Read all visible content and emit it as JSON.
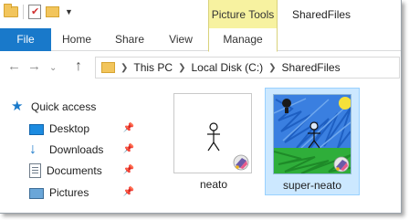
{
  "window": {
    "title": "SharedFiles",
    "context_tab_group": "Picture Tools"
  },
  "quick_access_toolbar": {
    "icons": [
      "folder-icon",
      "properties-icon",
      "new-folder-icon",
      "customize-dropdown-icon"
    ]
  },
  "ribbon": {
    "tabs": [
      {
        "label": "File",
        "active": true,
        "color": "#1979ca"
      },
      {
        "label": "Home"
      },
      {
        "label": "Share"
      },
      {
        "label": "View"
      },
      {
        "label": "Manage"
      }
    ],
    "context_color": "#f7f2a0"
  },
  "address_bar": {
    "breadcrumbs": [
      "This PC",
      "Local Disk (C:)",
      "SharedFiles"
    ]
  },
  "nav_pane": {
    "items": [
      {
        "label": "Quick access",
        "icon": "star-icon",
        "pinned": false
      },
      {
        "label": "Desktop",
        "icon": "desktop-icon",
        "pinned": true
      },
      {
        "label": "Downloads",
        "icon": "downloads-icon",
        "pinned": true
      },
      {
        "label": "Documents",
        "icon": "documents-icon",
        "pinned": true
      },
      {
        "label": "Pictures",
        "icon": "pictures-icon",
        "pinned": true
      }
    ]
  },
  "files": [
    {
      "name": "neato",
      "selected": false,
      "icon": "paint-file-thumbnail"
    },
    {
      "name": "super-neato",
      "selected": true,
      "icon": "paint-file-thumbnail"
    }
  ],
  "colors": {
    "selection_bg": "#cce8ff",
    "selection_border": "#99d1ff"
  }
}
